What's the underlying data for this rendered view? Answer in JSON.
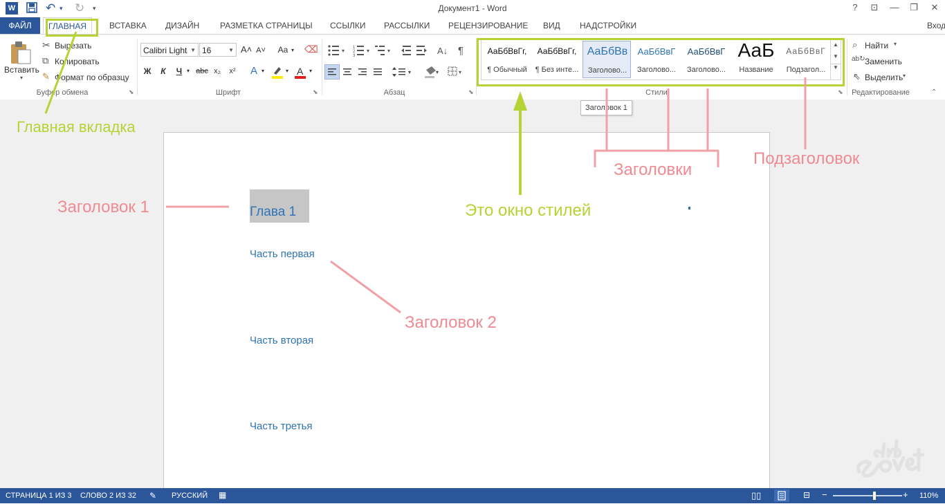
{
  "window": {
    "title": "Документ1 - Word",
    "controls": [
      "?",
      "⊡",
      "—",
      "❐",
      "✕"
    ],
    "login": "Вход"
  },
  "quick_access": {
    "app_icon": "word-icon",
    "save_icon": "save-icon",
    "undo_icon": "undo-icon",
    "redo_icon": "redo-icon",
    "customize_icon": "chevron-down-icon"
  },
  "tabs": [
    {
      "label": "ФАЙЛ"
    },
    {
      "label": "ГЛАВНАЯ"
    },
    {
      "label": "ВСТАВКА"
    },
    {
      "label": "ДИЗАЙН"
    },
    {
      "label": "РАЗМЕТКА СТРАНИЦЫ"
    },
    {
      "label": "ССЫЛКИ"
    },
    {
      "label": "РАССЫЛКИ"
    },
    {
      "label": "РЕЦЕНЗИРОВАНИЕ"
    },
    {
      "label": "ВИД"
    },
    {
      "label": "НАДСТРОЙКИ"
    }
  ],
  "ribbon": {
    "clipboard": {
      "group_label": "Буфер обмена",
      "paste": "Вставить",
      "cut": "Вырезать",
      "copy": "Копировать",
      "format_painter": "Формат по образцу"
    },
    "font": {
      "group_label": "Шрифт",
      "font_name": "Calibri Light",
      "font_size": "16",
      "bold": "Ж",
      "italic": "К",
      "underline": "Ч",
      "strike": "abc",
      "subscript": "x₂",
      "superscript": "x²",
      "change_case": "Aa"
    },
    "paragraph": {
      "group_label": "Абзац"
    },
    "styles": {
      "group_label": "Стили",
      "items": [
        {
          "preview": "АаБбВвГг,",
          "name": "¶ Обычный"
        },
        {
          "preview": "АаБбВвГг,",
          "name": "¶ Без инте..."
        },
        {
          "preview": "АаБбВв",
          "name": "Заголово..."
        },
        {
          "preview": "АаБбВвГ",
          "name": "Заголово..."
        },
        {
          "preview": "АаБбВвГ",
          "name": "Заголово..."
        },
        {
          "preview": "АаБ",
          "name": "Название"
        },
        {
          "preview": "АаБбВвГ",
          "name": "Подзагол..."
        }
      ]
    },
    "editing": {
      "group_label": "Редактирование",
      "find": "Найти",
      "replace": "Заменить",
      "select": "Выделить"
    }
  },
  "tooltip": "Заголовок 1",
  "document": {
    "headings": [
      "Глава 1",
      "Часть первая",
      "Часть вторая",
      "Часть третья"
    ]
  },
  "annotations": {
    "home_tab": "Главная вкладка",
    "styles_window": "Это окно стилей",
    "headings": "Заголовки",
    "subheading": "Подзаголовок",
    "heading1": "Заголовок 1",
    "heading2": "Заголовок 2"
  },
  "status": {
    "page": "СТРАНИЦА 1 ИЗ 3",
    "words": "СЛОВО 2 ИЗ 32",
    "language": "РУССКИЙ",
    "zoom": "110%",
    "zoom_fraction": 0.6
  },
  "watermark": "club Sovet",
  "colors": {
    "accent": "#2b579a",
    "annotation_green": "#b5d334",
    "annotation_pink": "#f08a93",
    "heading_blue": "#2e74b5"
  }
}
